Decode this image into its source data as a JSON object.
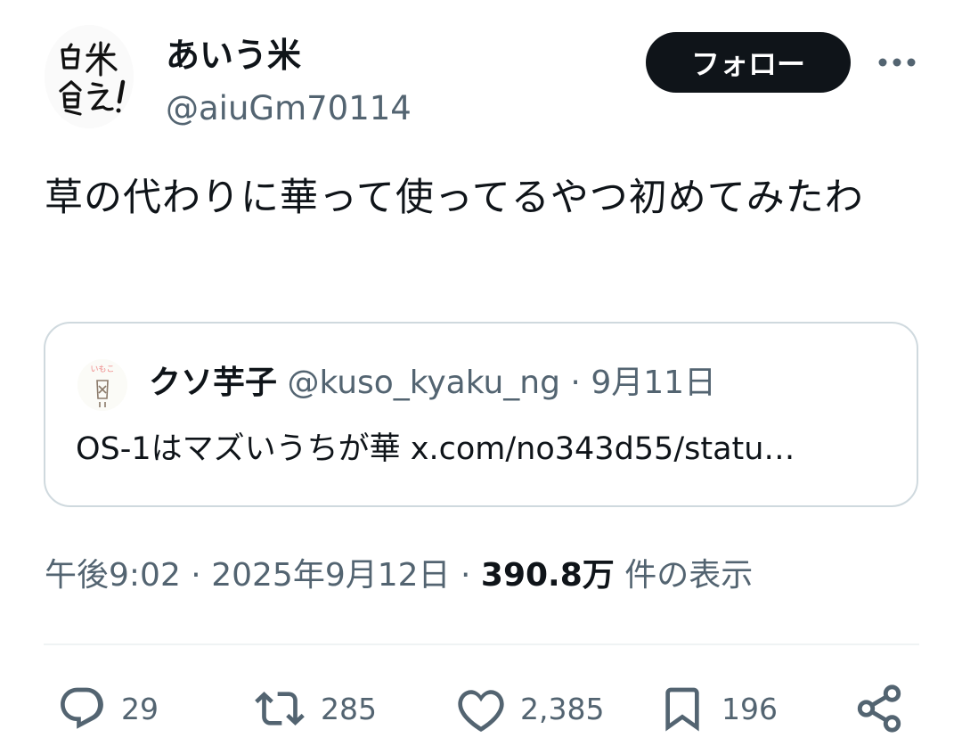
{
  "author": {
    "display_name": "あいう米",
    "handle": "@aiuGm70114",
    "avatar_text": "白米食え!"
  },
  "follow_button": {
    "label": "フォロー"
  },
  "more_button": {
    "icon": "more-horizontal-icon"
  },
  "tweet": {
    "text": "草の代わりに華って使ってるやつ初めてみたわ"
  },
  "quote": {
    "display_name": "クソ芋子",
    "handle": "@kuso_kyaku_ng",
    "separator": "·",
    "date": "9月11日",
    "text": "OS-1はマズいうちが華 x.com/no343d55/statu…",
    "avatar_text": "いもこ"
  },
  "meta": {
    "time": "午後9:02",
    "sep1": "·",
    "date": "2025年9月12日",
    "sep2": "·",
    "views_count": "390.8万",
    "views_label": "件の表示"
  },
  "actions": {
    "reply": {
      "icon": "reply-icon",
      "count": "29"
    },
    "retweet": {
      "icon": "retweet-icon",
      "count": "285"
    },
    "like": {
      "icon": "heart-icon",
      "count": "2,385"
    },
    "bookmark": {
      "icon": "bookmark-icon",
      "count": "196"
    },
    "share": {
      "icon": "share-icon"
    }
  },
  "colors": {
    "text_primary": "#0f1419",
    "text_secondary": "#536471",
    "border": "#cfd9de",
    "divider": "#eff3f4",
    "button_bg": "#0f1419",
    "button_text": "#ffffff"
  }
}
